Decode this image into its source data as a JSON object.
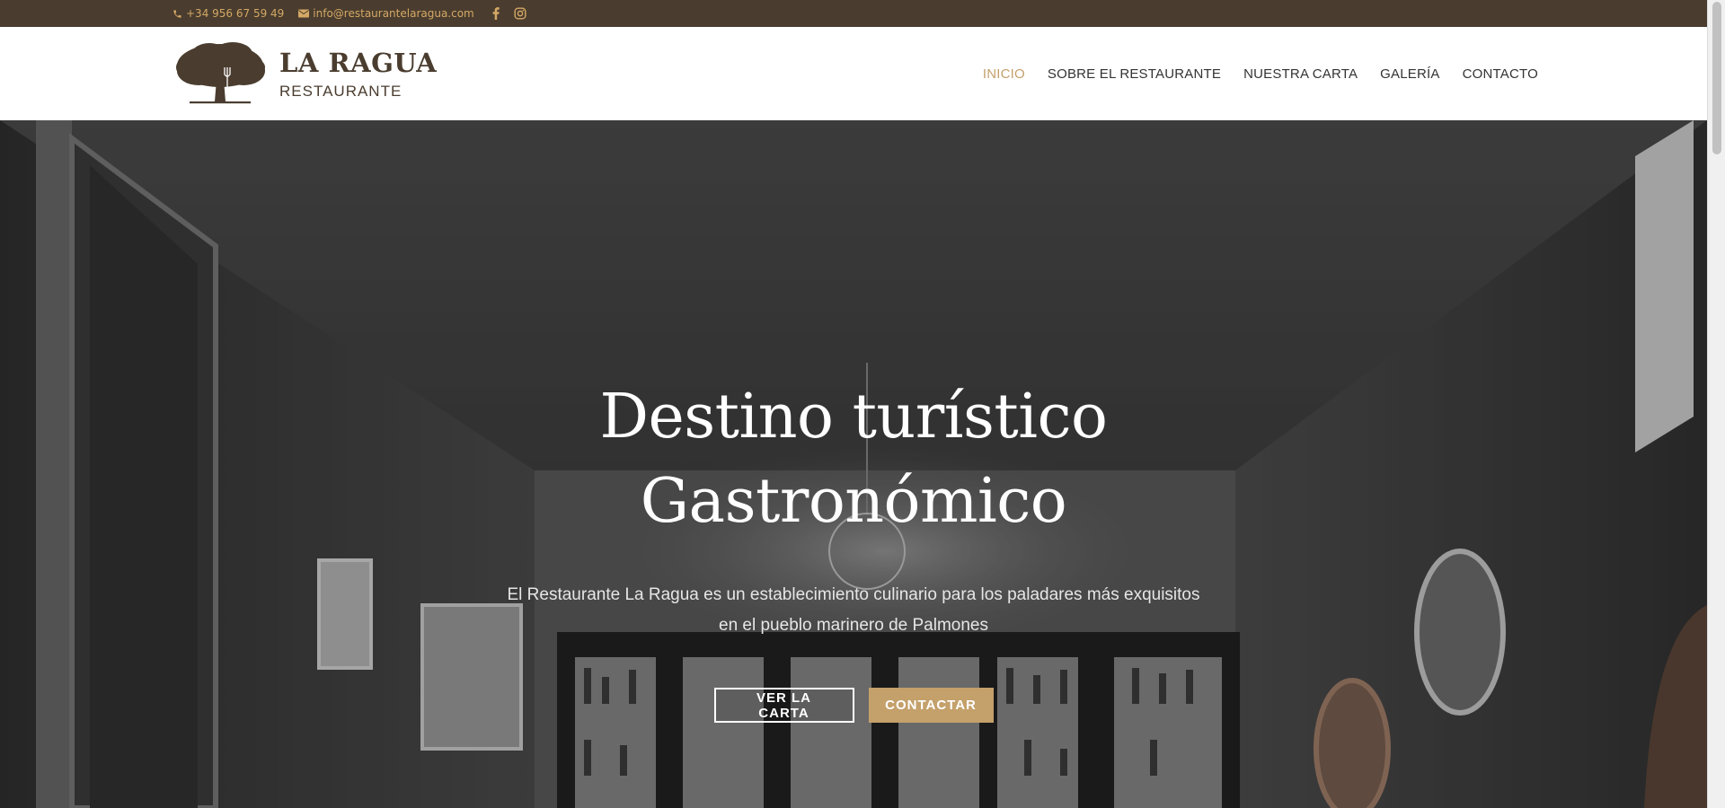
{
  "topbar": {
    "phone": "+34 956 67 59 49",
    "email": "info@restaurantelaragua.com",
    "icons": [
      "phone-icon",
      "mail-icon",
      "facebook-icon",
      "instagram-icon"
    ],
    "color": "#d4a865",
    "background": "#4a3d2f"
  },
  "header": {
    "logo": {
      "name": "LA RAGUA",
      "subtitle": "RESTAURANTE",
      "icon": "tree-logo-icon",
      "color": "#4a3d2f"
    },
    "nav": {
      "active_color": "#c4a06b",
      "items": [
        {
          "label": "INICIO",
          "active": true
        },
        {
          "label": "SOBRE EL RESTAURANTE",
          "active": false
        },
        {
          "label": "NUESTRA CARTA",
          "active": false
        },
        {
          "label": "GALERÍA",
          "active": false
        },
        {
          "label": "CONTACTO",
          "active": false
        }
      ]
    }
  },
  "hero": {
    "title_line1": "Destino turístico",
    "title_line2": "Gastronómico",
    "description": "El Restaurante La Ragua es un establecimiento culinario para los paladares más exquisitos en el pueblo marinero de Palmones",
    "buttons": {
      "primary": "VER LA CARTA",
      "secondary": "CONTACTAR"
    },
    "accent_color": "#c4a06b"
  }
}
